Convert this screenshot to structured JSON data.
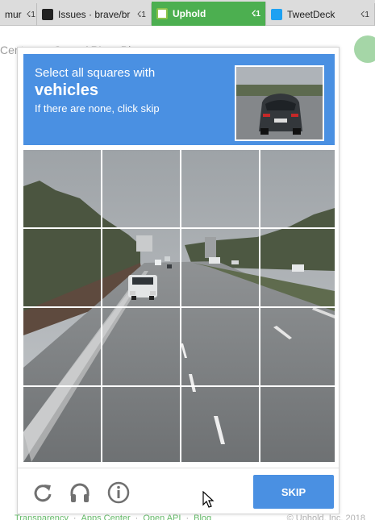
{
  "browser": {
    "tabs": [
      {
        "label": "mur",
        "users": "☇1",
        "favicon": "none",
        "active": false
      },
      {
        "label": "Issues · brave/br",
        "users": "☇1",
        "favicon": "github-icon",
        "active": false
      },
      {
        "label": "Uphold",
        "users": "☇1",
        "favicon": "uphold-icon",
        "active": true
      },
      {
        "label": "TweetDeck",
        "users": "☇1",
        "favicon": "twitter-icon",
        "active": false
      }
    ]
  },
  "background_page": {
    "nav": [
      "Centre",
      "Open API",
      "Blog"
    ],
    "footer": [
      "Transparency",
      "Apps Center",
      "Open API",
      "Blog"
    ],
    "footer_separator": "·",
    "copyright": "© Uphold, Inc. 2018"
  },
  "captcha": {
    "instruction_line1": "Select all squares with",
    "target": "vehicles",
    "instruction_line3": "If there are none, click skip",
    "skip_label": "SKIP",
    "grid_size": 4,
    "accent_color": "#4a90e2"
  },
  "colors": {
    "active_tab": "#4caf50",
    "link_green": "#66bb6a"
  }
}
